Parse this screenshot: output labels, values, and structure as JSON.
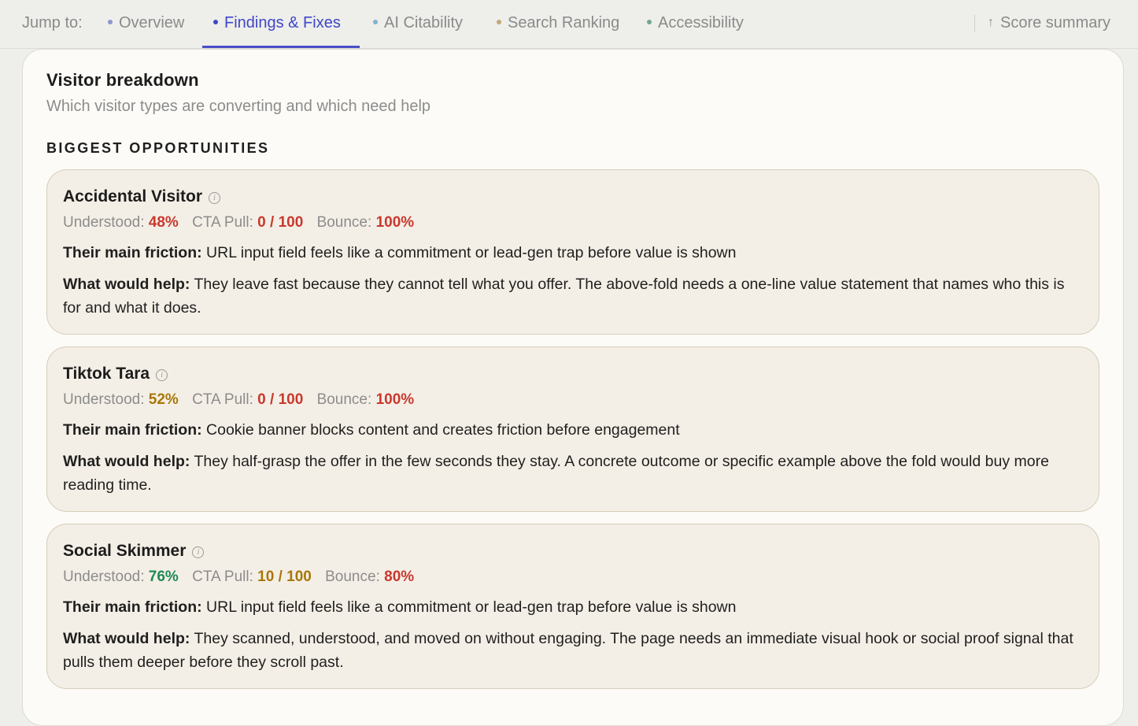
{
  "nav": {
    "jump_label": "Jump to:",
    "tabs": [
      {
        "label": "Overview",
        "dot_color": "#8f96cf",
        "active": false
      },
      {
        "label": "Findings & Fixes",
        "dot_color": "#3f46c8",
        "active": true
      },
      {
        "label": "AI Citability",
        "dot_color": "#7fb3cc",
        "active": false
      },
      {
        "label": "Search Ranking",
        "dot_color": "#c4a774",
        "active": false
      },
      {
        "label": "Accessibility",
        "dot_color": "#6faa8a",
        "active": false
      }
    ],
    "score_summary": "Score summary",
    "score_summary_arrow": "↑"
  },
  "panel": {
    "title": "Visitor breakdown",
    "subtitle": "Which visitor types are converting and which need help",
    "section_heading": "BIGGEST OPPORTUNITIES"
  },
  "labels": {
    "understood": "Understood:",
    "cta_pull": "CTA Pull:",
    "bounce": "Bounce:",
    "friction": "Their main friction:",
    "help": "What would help:"
  },
  "cards": [
    {
      "name": "Accidental Visitor",
      "understood": "48%",
      "cta_pull": "0 / 100",
      "bounce": "100%",
      "friction": "URL input field feels like a commitment or lead-gen trap before value is shown",
      "help": "They leave fast because they cannot tell what you offer. The above-fold needs a one-line value statement that names who this is for and what it does."
    },
    {
      "name": "Tiktok Tara",
      "understood": "52%",
      "cta_pull": "0 / 100",
      "bounce": "100%",
      "friction": "Cookie banner blocks content and creates friction before engagement",
      "help": "They half-grasp the offer in the few seconds they stay. A concrete outcome or specific example above the fold would buy more reading time."
    },
    {
      "name": "Social Skimmer",
      "understood": "76%",
      "cta_pull": "10 / 100",
      "bounce": "80%",
      "friction": "URL input field feels like a commitment or lead-gen trap before value is shown",
      "help": "They scanned, understood, and moved on without engaging. The page needs an immediate visual hook or social proof signal that pulls them deeper before they scroll past."
    }
  ],
  "colors": {
    "red": "#c8392f",
    "amber": "#a87709",
    "green": "#1f8a55",
    "accent": "#3f46c8"
  }
}
